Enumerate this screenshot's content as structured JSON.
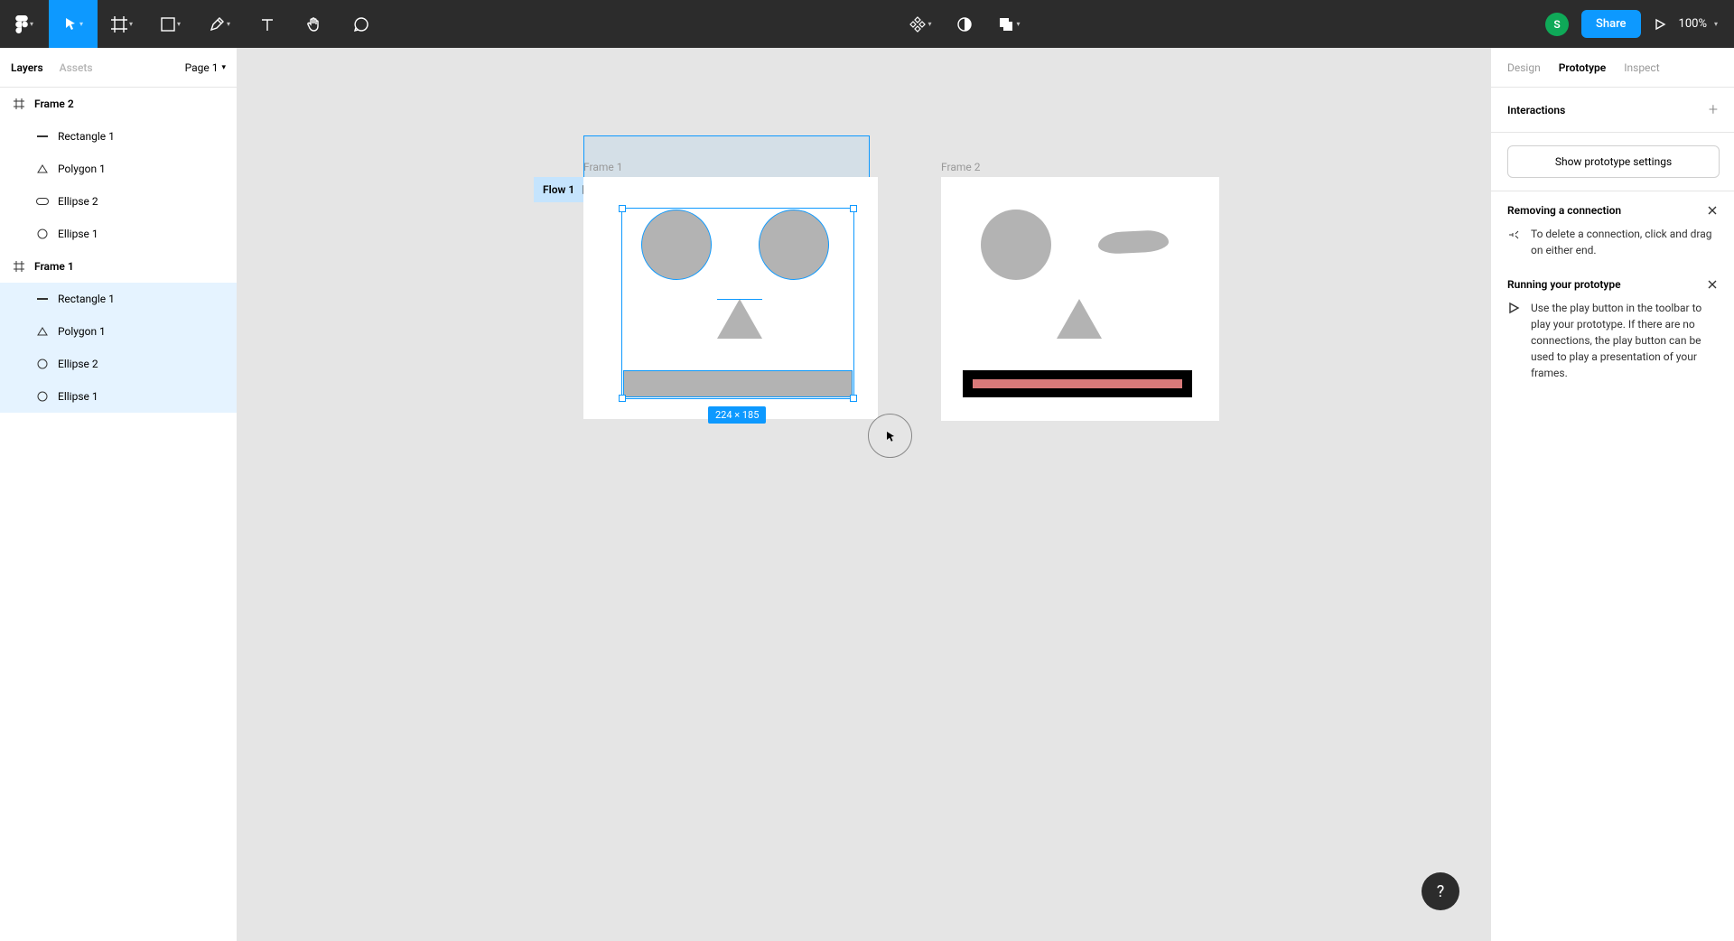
{
  "toolbar": {
    "avatar_initial": "S",
    "share_label": "Share",
    "zoom": "100%"
  },
  "left_panel": {
    "tabs": {
      "layers": "Layers",
      "assets": "Assets"
    },
    "page_selector": "Page 1",
    "layers": [
      {
        "label": "Frame 2",
        "type": "frame"
      },
      {
        "label": "Rectangle 1",
        "type": "rect"
      },
      {
        "label": "Polygon 1",
        "type": "poly"
      },
      {
        "label": "Ellipse 2",
        "type": "ellipse"
      },
      {
        "label": "Ellipse 1",
        "type": "ellipse"
      },
      {
        "label": "Frame 1",
        "type": "frame"
      },
      {
        "label": "Rectangle 1",
        "type": "rect"
      },
      {
        "label": "Polygon 1",
        "type": "poly"
      },
      {
        "label": "Ellipse 2",
        "type": "ellipse"
      },
      {
        "label": "Ellipse 1",
        "type": "ellipse"
      }
    ]
  },
  "canvas": {
    "frame1_label": "Frame 1",
    "frame2_label": "Frame 2",
    "flow_badge": "Flow 1",
    "dimensions": "224 × 185"
  },
  "right_panel": {
    "tabs": {
      "design": "Design",
      "prototype": "Prototype",
      "inspect": "Inspect"
    },
    "interactions_title": "Interactions",
    "settings_button": "Show prototype settings",
    "tips": [
      {
        "title": "Removing a connection",
        "body": "To delete a connection, click and drag on either end."
      },
      {
        "title": "Running your prototype",
        "body": "Use the play button in the toolbar to play your prototype. If there are no connections, the play button can be used to play a presentation of your frames."
      }
    ]
  },
  "help_label": "?"
}
